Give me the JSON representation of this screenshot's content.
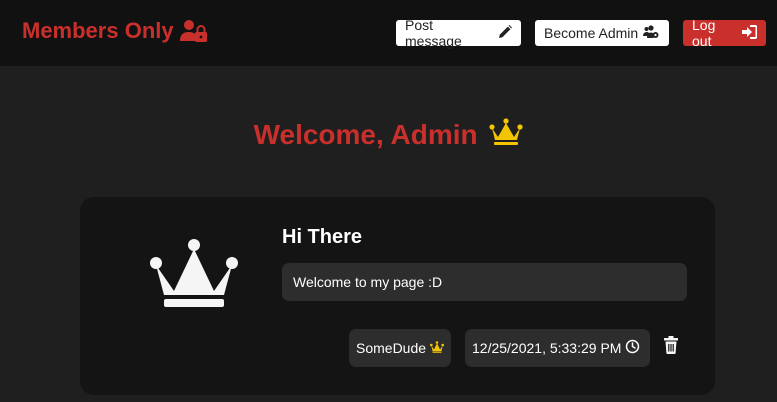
{
  "app": {
    "title": "Members Only"
  },
  "nav": {
    "post_label": "Post message",
    "admin_label": "Become Admin",
    "logout_label": "Log out"
  },
  "welcome": {
    "text": "Welcome, Admin"
  },
  "messages": [
    {
      "title": "Hi There",
      "body": "Welcome to my page :D",
      "author": "SomeDude",
      "timestamp": "12/25/2021, 5:33:29 PM"
    }
  ],
  "colors": {
    "brand_red": "#c9302c",
    "crown_gold": "#f2c500",
    "background": "#1f1f1f",
    "topbar": "#111111"
  },
  "icons": {
    "brand": "user-lock-icon",
    "post": "pencil-icon",
    "admin": "users-cog-icon",
    "logout": "sign-in-icon",
    "welcome": "crown-icon",
    "avatar": "crown-icon",
    "author": "crown-icon",
    "time": "clock-icon",
    "delete": "trash-icon"
  }
}
